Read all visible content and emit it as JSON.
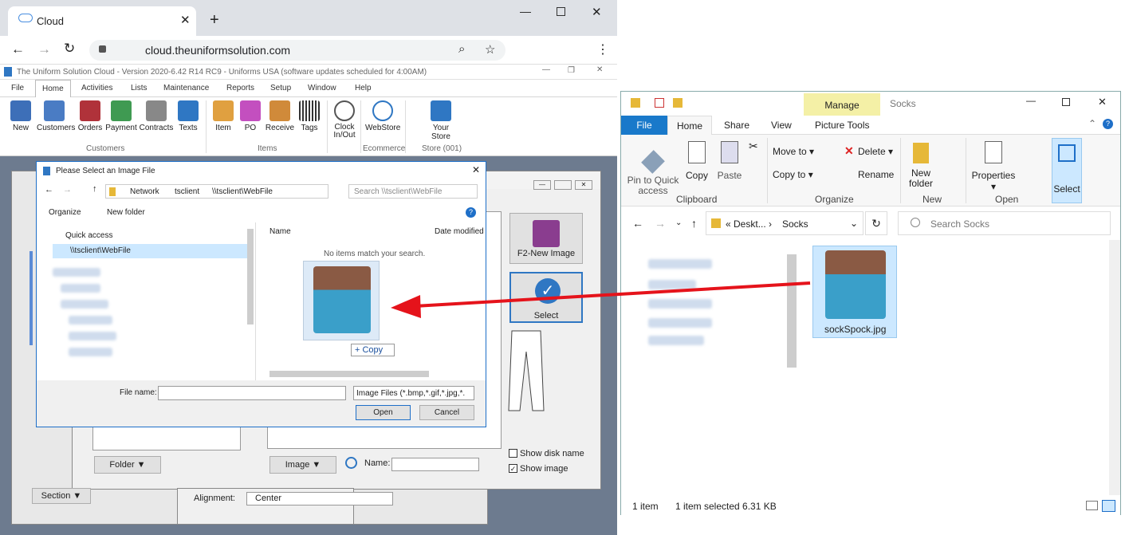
{
  "browser": {
    "tab_title": "Cloud",
    "url": "cloud.theuniformsolution.com"
  },
  "app": {
    "title": "The Uniform Solution Cloud - Version 2020-6.42 R14 RC9 - Uniforms USA (software updates scheduled for  4:00AM)",
    "menu": [
      "File",
      "Home",
      "Activities",
      "Lists",
      "Maintenance",
      "Reports",
      "Setup",
      "Window",
      "Help"
    ],
    "ribbon": [
      {
        "label": "New",
        "color": "#3d6fb8"
      },
      {
        "label": "Customers",
        "color": "#4a7cc4"
      },
      {
        "label": "Orders",
        "color": "#b0323a"
      },
      {
        "label": "Payment",
        "color": "#3f9a52"
      },
      {
        "label": "Contracts",
        "color": "#888"
      },
      {
        "label": "Texts",
        "color": "#2f77c3"
      },
      {
        "label": "Item",
        "color": "#e0a040"
      },
      {
        "label": "PO",
        "color": "#c34fbf"
      },
      {
        "label": "Receive",
        "color": "#d08a3a"
      },
      {
        "label": "Tags",
        "color": "#444"
      },
      {
        "label": "Clock\nIn/Out",
        "color": "#555"
      },
      {
        "label": "WebStore",
        "color": "#2f77c3"
      },
      {
        "label": "Your\nStore",
        "color": "#2f77c3"
      }
    ],
    "groups": [
      "Customers",
      "Items",
      "Ecommerce",
      "Store (001)"
    ]
  },
  "dialog": {
    "title": "Please Select an Image File",
    "path": [
      "Network",
      "tsclient",
      "\\\\tsclient\\WebFile"
    ],
    "search_placeholder": "Search \\\\tsclient\\WebFile",
    "organize": "Organize",
    "new_folder": "New folder",
    "quick_access": "Quick access",
    "pinned": "\\\\tsclient\\WebFile",
    "col_name": "Name",
    "col_date": "Date modified",
    "empty_msg": "No items match your search.",
    "drag_copy": "+ Copy",
    "file_name_label": "File name:",
    "file_type": "Image Files (*.bmp,*.gif,*.jpg,*.",
    "open": "Open",
    "cancel": "Cancel"
  },
  "side_panel": {
    "new_image": "F2-New Image",
    "select": "Select",
    "show_disk": "Show disk name",
    "show_image": "Show image",
    "folder": "Folder",
    "image": "Image",
    "name_label": "Name:",
    "section": "Section",
    "alignment_label": "Alignment:",
    "alignment_value": "Center"
  },
  "explorer": {
    "title": "Socks",
    "manage": "Manage",
    "tabs": [
      "File",
      "Home",
      "Share",
      "View",
      "Picture Tools"
    ],
    "pin": "Pin to Quick\naccess",
    "copy": "Copy",
    "paste": "Paste",
    "move_to": "Move to",
    "copy_to": "Copy to",
    "delete": "Delete",
    "rename": "Rename",
    "new_folder": "New\nfolder",
    "properties": "Properties",
    "select": "Select",
    "groups": [
      "Clipboard",
      "Organize",
      "New",
      "Open"
    ],
    "breadcrumb": [
      "Deskt...",
      "Socks"
    ],
    "search_placeholder": "Search Socks",
    "file_name": "sockSpock.jpg",
    "status_items": "1 item",
    "status_selected": "1 item selected  6.31 KB"
  },
  "colors": {
    "accent": "#0078d7",
    "arrow": "#e5131b",
    "manage": "#f4f0a6"
  }
}
